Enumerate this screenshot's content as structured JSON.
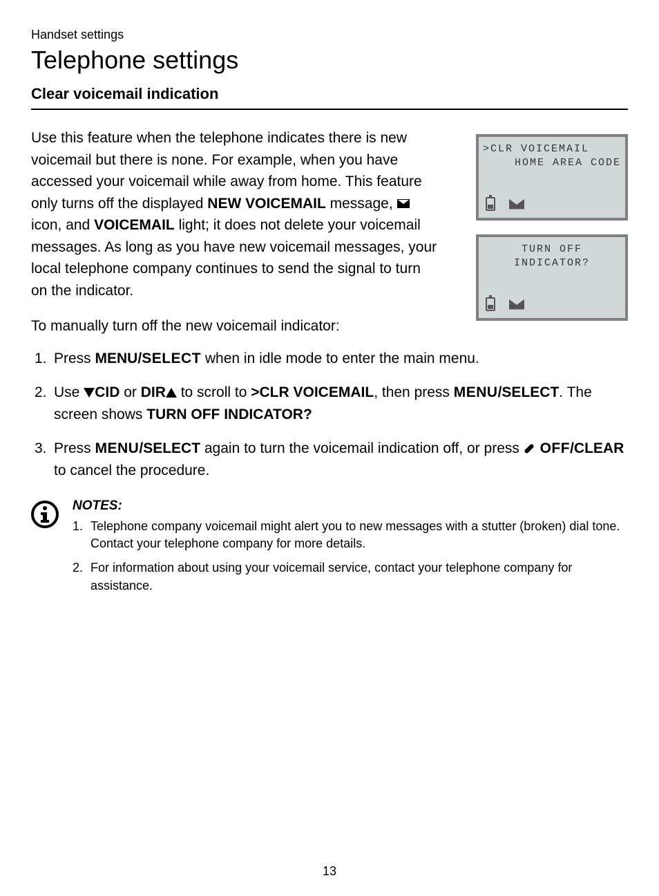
{
  "breadcrumb": "Handset settings",
  "page_title": "Telephone settings",
  "section_title": "Clear voicemail indication",
  "intro": {
    "part1": "Use this feature when the telephone indicates there is new voicemail but there is none. For example, when you have accessed your voicemail while away from home. This feature only turns off the displayed ",
    "bold1": "NEW VOICEMAIL",
    "part2": " message, ",
    "part3": " icon, and ",
    "bold2": "VOICEMAIL",
    "part4": " light; it does not delete your voicemail messages. As long as you have new voicemail messages, your local telephone company continues to send the signal to turn on the indicator."
  },
  "sub_heading": "To manually turn off the new voicemail indicator:",
  "steps": {
    "s1": {
      "part1": "Press ",
      "bold1": "MENU/",
      "sc1": "SELECT",
      "part2": " when in idle mode to enter the main menu."
    },
    "s2": {
      "part1": "Use ",
      "cid": "CID",
      "or": " or ",
      "dir": "DIR",
      "part2": " to scroll to ",
      "bold1": ">CLR VOICEMAIL",
      "part3": ", then press ",
      "sc1": "MENU",
      "bold2": "/SELECT",
      "part4": ". The screen shows ",
      "bold3": "TURN OFF INDICATOR?"
    },
    "s3": {
      "part1": "Press ",
      "sc1": "MENU",
      "bold1": "/SELECT",
      "part2": " again to turn the voicemail indication off, or press ",
      "sc2": "OFF",
      "bold2": "/CLEAR",
      "part3": " to cancel the procedure."
    }
  },
  "notes": {
    "title": "NOTES",
    "n1": "Telephone company voicemail might alert you to new messages with a stutter (broken) dial tone. Contact your telephone company for more details.",
    "n2": "For information about using your voicemail service, contact your telephone company for assistance."
  },
  "screens": {
    "s1": {
      "line1": ">CLR VOICEMAIL",
      "line2": "HOME AREA CODE"
    },
    "s2": {
      "line1": "TURN OFF",
      "line2": "INDICATOR?"
    }
  },
  "page_number": "13"
}
